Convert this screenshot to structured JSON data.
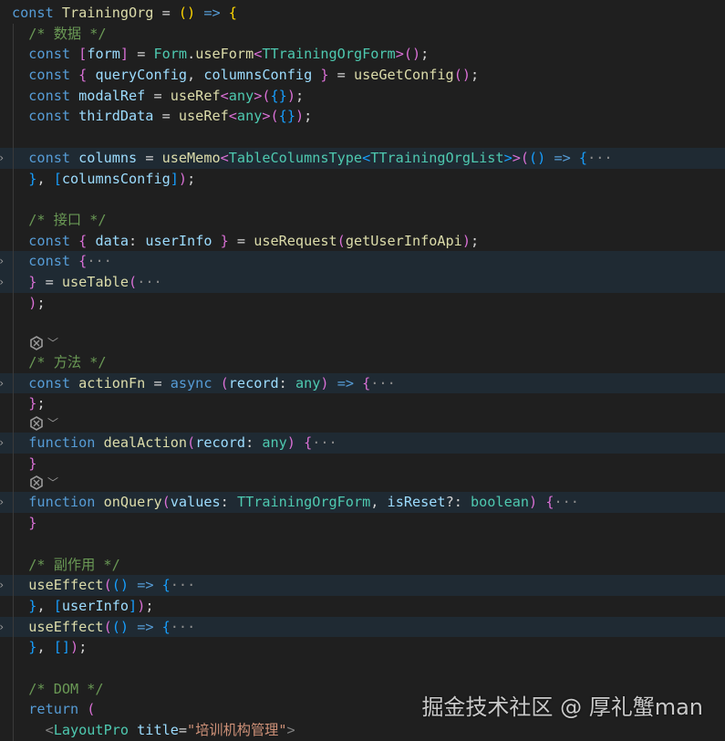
{
  "editor": {
    "lines": [
      {
        "hl": false,
        "tokens": [
          [
            "kw",
            "const "
          ],
          [
            "fn",
            "TrainingOrg"
          ],
          [
            "p",
            " = "
          ],
          [
            "b1",
            "()"
          ],
          [
            "kw",
            " => "
          ],
          [
            "b1",
            "{"
          ]
        ]
      },
      {
        "hl": false,
        "tokens": [
          [
            "cm",
            "  /* 数据 */"
          ]
        ]
      },
      {
        "hl": false,
        "tokens": [
          [
            "kw",
            "  const "
          ],
          [
            "b2",
            "["
          ],
          [
            "var",
            "form"
          ],
          [
            "b2",
            "]"
          ],
          [
            "p",
            " = "
          ],
          [
            "type",
            "Form"
          ],
          [
            "p",
            "."
          ],
          [
            "fn",
            "useForm"
          ],
          [
            "b2",
            "<"
          ],
          [
            "type",
            "TTrainingOrgForm"
          ],
          [
            "b2",
            ">"
          ],
          [
            "b2",
            "()"
          ],
          [
            "p",
            ";"
          ]
        ]
      },
      {
        "hl": false,
        "tokens": [
          [
            "kw",
            "  const "
          ],
          [
            "b2",
            "{"
          ],
          [
            "var",
            " queryConfig"
          ],
          [
            "p",
            ", "
          ],
          [
            "var",
            "columnsConfig "
          ],
          [
            "b2",
            "}"
          ],
          [
            "p",
            " = "
          ],
          [
            "fn",
            "useGetConfig"
          ],
          [
            "b2",
            "()"
          ],
          [
            "p",
            ";"
          ]
        ]
      },
      {
        "hl": false,
        "tokens": [
          [
            "kw",
            "  const "
          ],
          [
            "var",
            "modalRef"
          ],
          [
            "p",
            " = "
          ],
          [
            "fn",
            "useRef"
          ],
          [
            "b2",
            "<"
          ],
          [
            "type",
            "any"
          ],
          [
            "b2",
            ">"
          ],
          [
            "b2",
            "("
          ],
          [
            "b3",
            "{}"
          ],
          [
            "b2",
            ")"
          ],
          [
            "p",
            ";"
          ]
        ]
      },
      {
        "hl": false,
        "tokens": [
          [
            "kw",
            "  const "
          ],
          [
            "var",
            "thirdData"
          ],
          [
            "p",
            " = "
          ],
          [
            "fn",
            "useRef"
          ],
          [
            "b2",
            "<"
          ],
          [
            "type",
            "any"
          ],
          [
            "b2",
            ">"
          ],
          [
            "b2",
            "("
          ],
          [
            "b3",
            "{}"
          ],
          [
            "b2",
            ")"
          ],
          [
            "p",
            ";"
          ]
        ]
      },
      {
        "hl": false,
        "tokens": []
      },
      {
        "hl": true,
        "fold": true,
        "tokens": [
          [
            "kw",
            "  const "
          ],
          [
            "var",
            "columns"
          ],
          [
            "p",
            " = "
          ],
          [
            "fn",
            "useMemo"
          ],
          [
            "b2",
            "<"
          ],
          [
            "type",
            "TableColumnsType"
          ],
          [
            "b3",
            "<"
          ],
          [
            "type",
            "TTrainingOrgList"
          ],
          [
            "b3",
            ">"
          ],
          [
            "b2",
            ">"
          ],
          [
            "b2",
            "("
          ],
          [
            "b3",
            "()"
          ],
          [
            "kw",
            " => "
          ],
          [
            "b3",
            "{"
          ],
          [
            "ell",
            "···"
          ]
        ]
      },
      {
        "hl": false,
        "tokens": [
          [
            "b3",
            "  }"
          ],
          [
            "p",
            ", "
          ],
          [
            "b3",
            "["
          ],
          [
            "var",
            "columnsConfig"
          ],
          [
            "b3",
            "]"
          ],
          [
            "b2",
            ")"
          ],
          [
            "p",
            ";"
          ]
        ]
      },
      {
        "hl": false,
        "tokens": []
      },
      {
        "hl": false,
        "tokens": [
          [
            "cm",
            "  /* 接口 */"
          ]
        ]
      },
      {
        "hl": false,
        "tokens": [
          [
            "kw",
            "  const "
          ],
          [
            "b2",
            "{ "
          ],
          [
            "var",
            "data"
          ],
          [
            "p",
            ": "
          ],
          [
            "var",
            "userInfo "
          ],
          [
            "b2",
            "}"
          ],
          [
            "p",
            " = "
          ],
          [
            "fn",
            "useRequest"
          ],
          [
            "b2",
            "("
          ],
          [
            "fn",
            "getUserInfoApi"
          ],
          [
            "b2",
            ")"
          ],
          [
            "p",
            ";"
          ]
        ]
      },
      {
        "hl": true,
        "fold": true,
        "tokens": [
          [
            "kw",
            "  const "
          ],
          [
            "b2",
            "{"
          ],
          [
            "ell",
            "···"
          ]
        ]
      },
      {
        "hl": true,
        "fold": true,
        "tokens": [
          [
            "b2",
            "  }"
          ],
          [
            "p",
            " = "
          ],
          [
            "fn",
            "useTable"
          ],
          [
            "b2",
            "("
          ],
          [
            "ell",
            "···"
          ]
        ]
      },
      {
        "hl": false,
        "tokens": [
          [
            "b2",
            "  )"
          ],
          [
            "p",
            ";"
          ]
        ]
      },
      {
        "hl": false,
        "tokens": []
      },
      {
        "icon": true
      },
      {
        "hl": false,
        "tokens": [
          [
            "cm",
            "  /* 方法 */"
          ]
        ]
      },
      {
        "hl": true,
        "fold": true,
        "tokens": [
          [
            "kw",
            "  const "
          ],
          [
            "fn",
            "actionFn"
          ],
          [
            "p",
            " = "
          ],
          [
            "kw",
            "async "
          ],
          [
            "b2",
            "("
          ],
          [
            "var",
            "record"
          ],
          [
            "p",
            ": "
          ],
          [
            "type",
            "any"
          ],
          [
            "b2",
            ")"
          ],
          [
            "kw",
            " => "
          ],
          [
            "b2",
            "{"
          ],
          [
            "ell",
            "···"
          ]
        ]
      },
      {
        "hl": false,
        "tokens": [
          [
            "b2",
            "  }"
          ],
          [
            "p",
            ";"
          ]
        ]
      },
      {
        "icon": true
      },
      {
        "hl": true,
        "fold": true,
        "tokens": [
          [
            "kw",
            "  function "
          ],
          [
            "fn",
            "dealAction"
          ],
          [
            "b2",
            "("
          ],
          [
            "var",
            "record"
          ],
          [
            "p",
            ": "
          ],
          [
            "type",
            "any"
          ],
          [
            "b2",
            ")"
          ],
          [
            "p",
            " "
          ],
          [
            "b2",
            "{"
          ],
          [
            "ell",
            "···"
          ]
        ]
      },
      {
        "hl": false,
        "tokens": [
          [
            "b2",
            "  }"
          ]
        ]
      },
      {
        "icon": true
      },
      {
        "hl": true,
        "fold": true,
        "tokens": [
          [
            "kw",
            "  function "
          ],
          [
            "fn",
            "onQuery"
          ],
          [
            "b2",
            "("
          ],
          [
            "var",
            "values"
          ],
          [
            "p",
            ": "
          ],
          [
            "type",
            "TTrainingOrgForm"
          ],
          [
            "p",
            ", "
          ],
          [
            "var",
            "isReset"
          ],
          [
            "p",
            "?: "
          ],
          [
            "type",
            "boolean"
          ],
          [
            "b2",
            ")"
          ],
          [
            "p",
            " "
          ],
          [
            "b2",
            "{"
          ],
          [
            "ell",
            "···"
          ]
        ]
      },
      {
        "hl": false,
        "tokens": [
          [
            "b2",
            "  }"
          ]
        ]
      },
      {
        "hl": false,
        "tokens": []
      },
      {
        "hl": false,
        "tokens": [
          [
            "cm",
            "  /* 副作用 */"
          ]
        ]
      },
      {
        "hl": true,
        "fold": true,
        "tokens": [
          [
            "fn",
            "  useEffect"
          ],
          [
            "b2",
            "("
          ],
          [
            "b3",
            "()"
          ],
          [
            "kw",
            " => "
          ],
          [
            "b3",
            "{"
          ],
          [
            "ell",
            "···"
          ]
        ]
      },
      {
        "hl": false,
        "tokens": [
          [
            "b3",
            "  }"
          ],
          [
            "p",
            ", "
          ],
          [
            "b3",
            "["
          ],
          [
            "var",
            "userInfo"
          ],
          [
            "b3",
            "]"
          ],
          [
            "b2",
            ")"
          ],
          [
            "p",
            ";"
          ]
        ]
      },
      {
        "hl": true,
        "fold": true,
        "tokens": [
          [
            "fn",
            "  useEffect"
          ],
          [
            "b2",
            "("
          ],
          [
            "b3",
            "()"
          ],
          [
            "kw",
            " => "
          ],
          [
            "b3",
            "{"
          ],
          [
            "ell",
            "···"
          ]
        ]
      },
      {
        "hl": false,
        "tokens": [
          [
            "b3",
            "  }"
          ],
          [
            "p",
            ", "
          ],
          [
            "b3",
            "[]"
          ],
          [
            "b2",
            ")"
          ],
          [
            "p",
            ";"
          ]
        ]
      },
      {
        "hl": false,
        "tokens": []
      },
      {
        "hl": false,
        "tokens": [
          [
            "cm",
            "  /* DOM */"
          ]
        ]
      },
      {
        "hl": false,
        "tokens": [
          [
            "kw",
            "  return "
          ],
          [
            "b2",
            "("
          ]
        ]
      },
      {
        "hl": false,
        "tokens": [
          [
            "ang",
            "    <"
          ],
          [
            "type",
            "LayoutPro"
          ],
          [
            "var",
            " title"
          ],
          [
            "p",
            "="
          ],
          [
            "str",
            "\"培训机构管理\""
          ],
          [
            "ang",
            ">"
          ]
        ]
      }
    ]
  },
  "watermark": "掘金技术社区 @ 厚礼蟹man"
}
